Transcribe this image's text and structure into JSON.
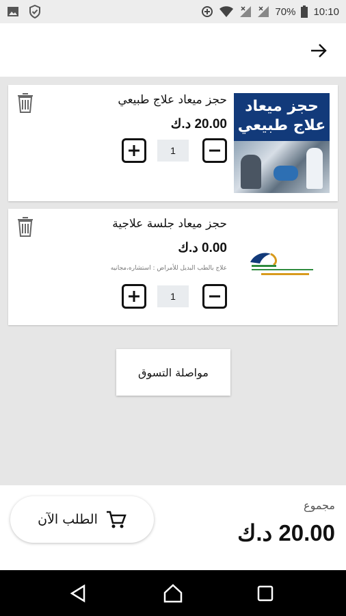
{
  "status_bar": {
    "battery": "70%",
    "time": "10:10",
    "icons": [
      "image-icon",
      "shield-check-icon",
      "data-saver-icon",
      "wifi-icon",
      "signal-icon",
      "signal-icon",
      "battery-icon"
    ]
  },
  "header": {
    "back_icon": "arrow-right-icon"
  },
  "cart": {
    "items": [
      {
        "title": "حجز ميعاد علاج طبيعي",
        "price": "20.00 د.ك",
        "quantity": "1",
        "image_text_line1": "حجز ميعاد",
        "image_text_line2": "علاج طبيعي"
      },
      {
        "title": "حجز ميعاد جلسة علاجية",
        "price": "0.00 د.ك",
        "note": "علاج بالطب البديل للأمراض : استشاره،مجانيه",
        "quantity": "1"
      }
    ]
  },
  "continue_label": "مواصلة التسوق",
  "checkout": {
    "order_label": "الطلب الآن",
    "total_label": "مجموع",
    "total_value": "20.00 د.ك"
  },
  "colors": {
    "banner_blue": "#123a7a",
    "logo_green": "#2e8b3d",
    "logo_gold": "#d89a1c"
  }
}
